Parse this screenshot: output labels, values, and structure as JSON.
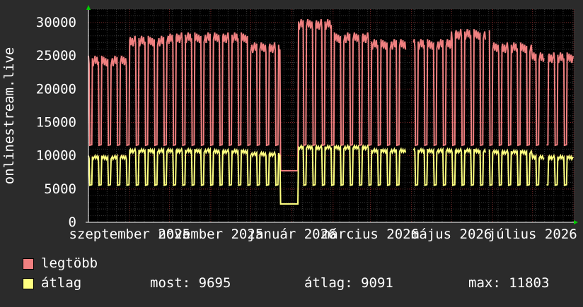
{
  "chart_data": {
    "type": "line",
    "ylabel": "onlinestream.live",
    "ylim": [
      0,
      32000
    ],
    "yticks": [
      "0",
      "5000",
      "10000",
      "15000",
      "20000",
      "25000",
      "30000"
    ],
    "x_tick_labels": [
      "szeptember 2025",
      "november 2025",
      "január 2026",
      "március 2026",
      "május 2026",
      "július 2026"
    ],
    "grid": true,
    "period_start": "2025-08-01",
    "period_end": "2026-08-01",
    "series": [
      {
        "name": "legtöbb",
        "color": "#f08080",
        "weekday_high": 27500,
        "weekend_low": 11500,
        "monthly_peaks": [
          {
            "month": "2025-08",
            "value": 25000
          },
          {
            "month": "2025-09",
            "value": 28000
          },
          {
            "month": "2025-10",
            "value": 28500
          },
          {
            "month": "2025-11",
            "value": 28500
          },
          {
            "month": "2025-12",
            "value": 27000
          },
          {
            "month": "2026-01",
            "value": 30500
          },
          {
            "month": "2026-02",
            "value": 28500
          },
          {
            "month": "2026-03",
            "value": 27500
          },
          {
            "month": "2026-04",
            "value": 27500
          },
          {
            "month": "2026-05",
            "value": 29000
          },
          {
            "month": "2026-06",
            "value": 27000
          },
          {
            "month": "2026-07",
            "value": 25500
          }
        ]
      },
      {
        "name": "átlag",
        "color": "#ffff80",
        "weekday_high": 10800,
        "weekend_low": 5500,
        "monthly_peaks": [
          {
            "month": "2025-08",
            "value": 10000
          },
          {
            "month": "2025-09",
            "value": 11000
          },
          {
            "month": "2025-10",
            "value": 11000
          },
          {
            "month": "2025-11",
            "value": 10900
          },
          {
            "month": "2025-12",
            "value": 10500
          },
          {
            "month": "2026-01",
            "value": 11500
          },
          {
            "month": "2026-02",
            "value": 11500
          },
          {
            "month": "2026-03",
            "value": 11000
          },
          {
            "month": "2026-04",
            "value": 11000
          },
          {
            "month": "2026-05",
            "value": 11000
          },
          {
            "month": "2026-06",
            "value": 10800
          },
          {
            "month": "2026-07",
            "value": 10000
          }
        ]
      }
    ],
    "gaps": [
      {
        "from": "2026-03-28",
        "to": "2026-04-02"
      },
      {
        "from": "2026-05-27",
        "to": "2026-05-29"
      },
      {
        "from": "2026-07-10",
        "to": "2026-07-11"
      }
    ]
  },
  "legend": {
    "max_label": "legtöbb",
    "avg_label": "átlag"
  },
  "stats": {
    "current": "most: 9695",
    "average": "átlag: 9091",
    "maximum": "max: 11803"
  },
  "colors": {
    "background": "#2b2b2b",
    "plot_background": "#000000",
    "grid_major": "#7a2a2a",
    "grid_minor": "#3a3a3a",
    "axis": "#ffffff",
    "arrow": "#00cc00"
  }
}
